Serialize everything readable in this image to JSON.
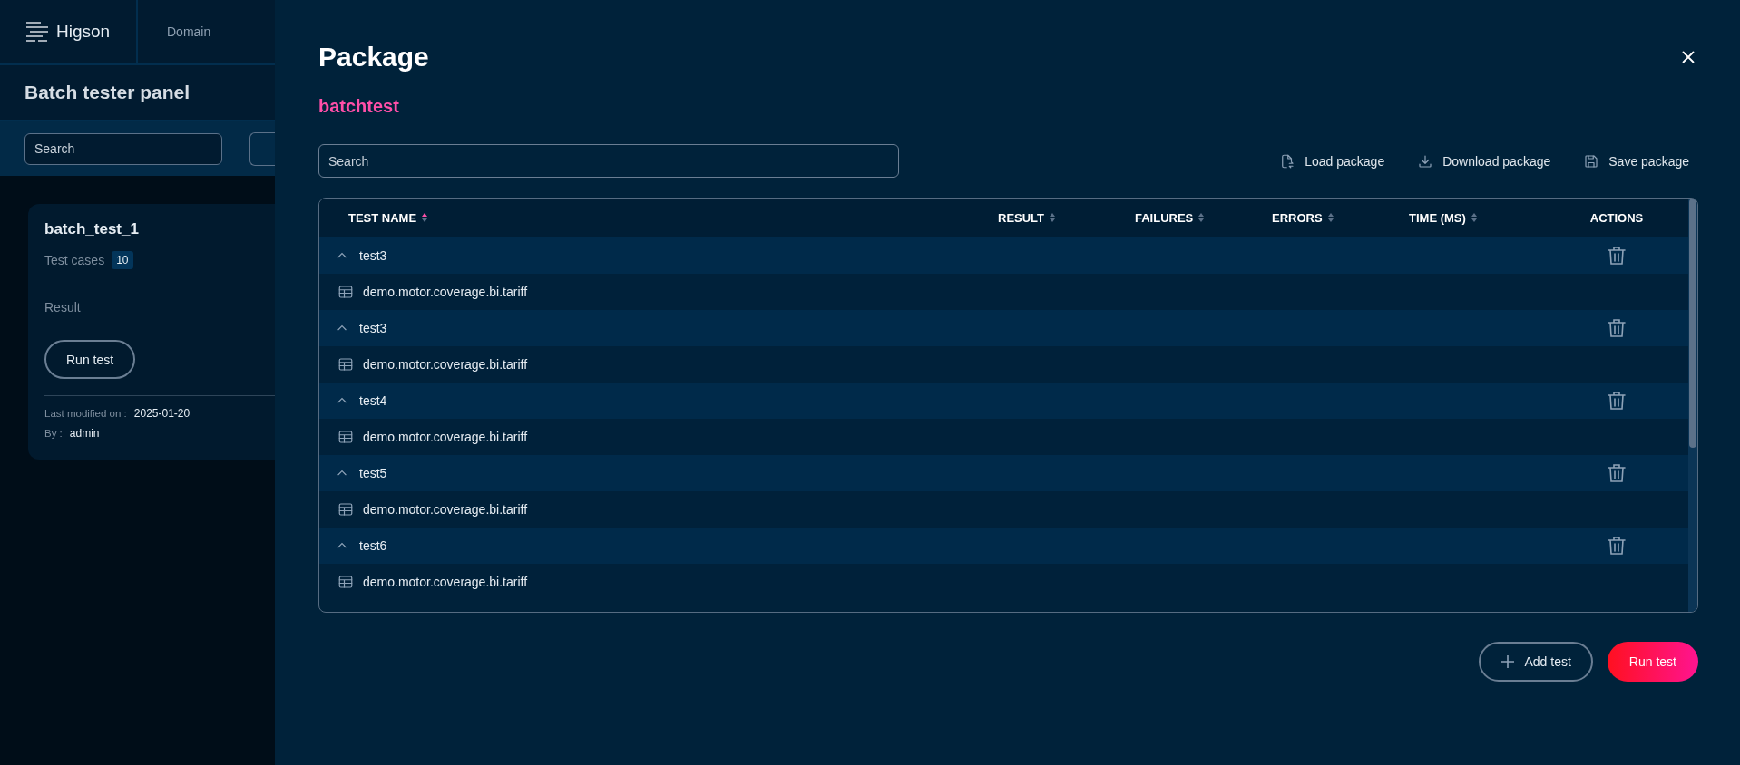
{
  "app": {
    "logo": "Higson",
    "nav": [
      "Domain"
    ],
    "page_title": "Batch tester panel",
    "search": {
      "placeholder": "Search"
    },
    "card": {
      "title": "batch_test_1",
      "test_cases_label": "Test cases",
      "test_cases_count": "10",
      "result_label": "Result",
      "run_button": "Run test",
      "modified_label": "Last modified on :",
      "modified_value": "2025-01-20",
      "by_label": "By :",
      "by_value": "admin"
    }
  },
  "modal": {
    "title": "Package",
    "package_name": "batchtest",
    "search": {
      "placeholder": "Search"
    },
    "toolbar": [
      {
        "kind": "load",
        "label": "Load package"
      },
      {
        "kind": "download",
        "label": "Download package"
      },
      {
        "kind": "save",
        "label": "Save package"
      }
    ],
    "table": {
      "columns": [
        {
          "label": "TEST NAME",
          "sorted": true
        },
        {
          "label": "RESULT",
          "sorted": false
        },
        {
          "label": "FAILURES",
          "sorted": false
        },
        {
          "label": "ERRORS",
          "sorted": false
        },
        {
          "label": "TIME (MS)",
          "sorted": false
        },
        {
          "label": "ACTIONS"
        }
      ],
      "rows": [
        {
          "name": "test3",
          "expanded": true,
          "children": [
            {
              "name": "demo.motor.coverage.bi.tariff"
            }
          ]
        },
        {
          "name": "test3",
          "expanded": true,
          "children": [
            {
              "name": "demo.motor.coverage.bi.tariff"
            }
          ]
        },
        {
          "name": "test4",
          "expanded": true,
          "children": [
            {
              "name": "demo.motor.coverage.bi.tariff"
            }
          ]
        },
        {
          "name": "test5",
          "expanded": true,
          "children": [
            {
              "name": "demo.motor.coverage.bi.tariff"
            }
          ]
        },
        {
          "name": "test6",
          "expanded": true,
          "children": [
            {
              "name": "demo.motor.coverage.bi.tariff"
            }
          ]
        }
      ]
    },
    "buttons": [
      {
        "kind": "secondary",
        "label": "Add test"
      },
      {
        "kind": "primary",
        "label": "Run test"
      }
    ]
  }
}
